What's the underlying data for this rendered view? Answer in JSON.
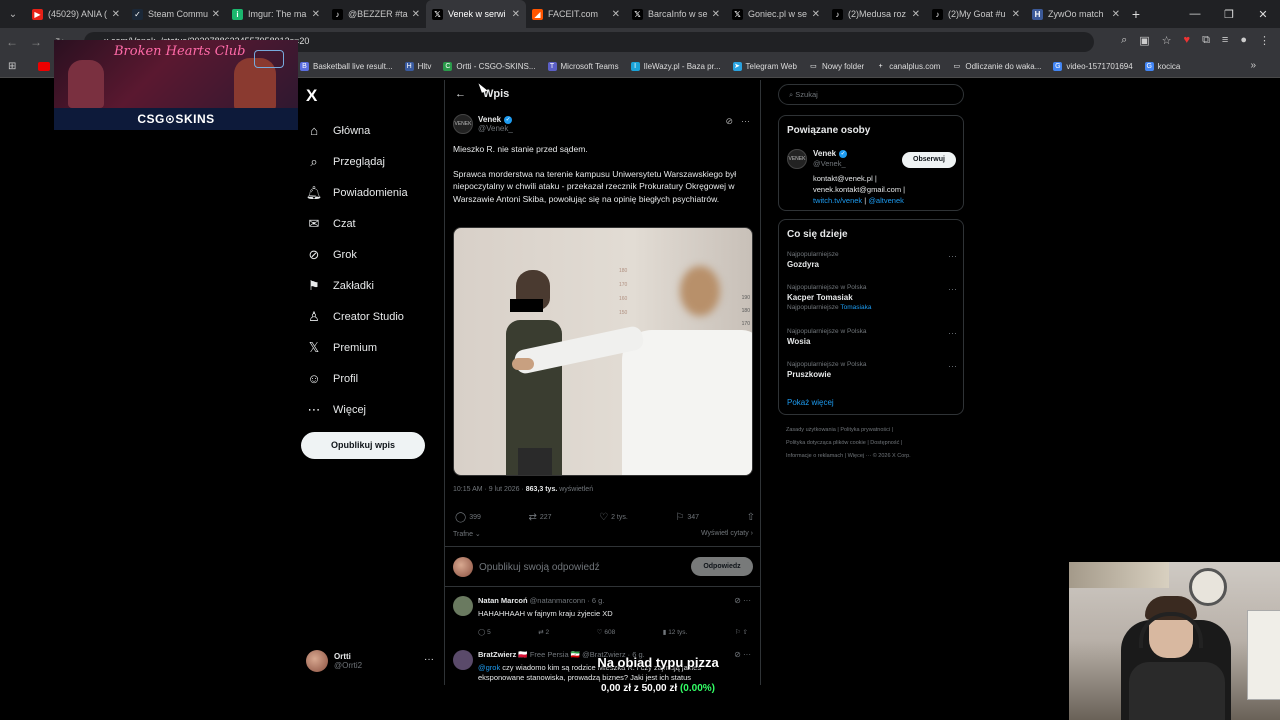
{
  "browser": {
    "tabs": [
      {
        "label": "(45029) ANIA (",
        "color": "#e62117",
        "icon": "youtube-icon",
        "glyph": "▶"
      },
      {
        "label": "Steam Commu",
        "color": "#1b2838",
        "icon": "steam-icon",
        "glyph": "✓"
      },
      {
        "label": "Imgur: The ma",
        "color": "#1bb76e",
        "icon": "imgur-icon",
        "glyph": "i"
      },
      {
        "label": "@BEZZER #ta",
        "color": "#000000",
        "icon": "tiktok-icon",
        "glyph": "♪"
      },
      {
        "label": "Venek w serwi",
        "color": "#000000",
        "icon": "x-icon",
        "glyph": "𝕏"
      },
      {
        "label": "FACEIT.com",
        "color": "#ff5500",
        "icon": "faceit-icon",
        "glyph": "◢"
      },
      {
        "label": "BarcaInfo w se",
        "color": "#000000",
        "icon": "x-icon",
        "glyph": "𝕏"
      },
      {
        "label": "Goniec.pl w se",
        "color": "#000000",
        "icon": "x-icon",
        "glyph": "𝕏"
      },
      {
        "label": "(2)Medusa roz",
        "color": "#000000",
        "icon": "tiktok-icon",
        "glyph": "♪"
      },
      {
        "label": "(2)My Goat #u",
        "color": "#000000",
        "icon": "tiktok-icon",
        "glyph": "♪"
      },
      {
        "label": "ZywOo match",
        "color": "#3b5998",
        "icon": "hltv-icon",
        "glyph": "H"
      }
    ],
    "active_tab": 4,
    "new_tab": "+",
    "url": "x.com/Venek_/status/20207886334557958913s=20",
    "window_controls": [
      "—",
      "❐",
      "✕"
    ],
    "bookmarks": [
      {
        "label": "Basketball live result...",
        "color": "#5b6ee1",
        "glyph": "B"
      },
      {
        "label": "Hltv",
        "color": "#3a5ba0",
        "glyph": "H"
      },
      {
        "label": "Ortti - CSGO-SKINS...",
        "color": "#2a9a4a",
        "glyph": "C"
      },
      {
        "label": "Microsoft Teams",
        "color": "#5b5fc7",
        "glyph": "T"
      },
      {
        "label": "IleWazy.pl - Baza pr...",
        "color": "#1aa3d9",
        "glyph": "I"
      },
      {
        "label": "Telegram Web",
        "color": "#2aa3e0",
        "glyph": "➤"
      },
      {
        "label": "Nowy folder",
        "color": "#35363a",
        "glyph": "▭"
      },
      {
        "label": "canalplus.com",
        "color": "#35363a",
        "glyph": "+"
      },
      {
        "label": "Odliczanie do waka...",
        "color": "#35363a",
        "glyph": "▭"
      },
      {
        "label": "video-1571701694",
        "color": "#4285f4",
        "glyph": "G"
      },
      {
        "label": "kocica",
        "color": "#4285f4",
        "glyph": "G"
      }
    ]
  },
  "banner": {
    "header": "Broken Hearts Club",
    "footer": "CSG⊙SKINS"
  },
  "x": {
    "logo": "X",
    "nav": [
      {
        "label": "Główna",
        "icon": "home-icon",
        "glyph": "⌂"
      },
      {
        "label": "Przeglądaj",
        "icon": "search-icon",
        "glyph": "⌕"
      },
      {
        "label": "Powiadomienia",
        "icon": "bell-icon",
        "glyph": "🔔︎"
      },
      {
        "label": "Czat",
        "icon": "chat-icon",
        "glyph": "✉"
      },
      {
        "label": "Grok",
        "icon": "grok-icon",
        "glyph": "⊘"
      },
      {
        "label": "Zakładki",
        "icon": "bookmark-icon",
        "glyph": "⚑"
      },
      {
        "label": "Creator Studio",
        "icon": "creator-studio-icon",
        "glyph": "♙"
      },
      {
        "label": "Premium",
        "icon": "x-premium-icon",
        "glyph": "𝕏"
      },
      {
        "label": "Profil",
        "icon": "profile-icon",
        "glyph": "☺"
      },
      {
        "label": "Więcej",
        "icon": "more-icon",
        "glyph": "⋯"
      }
    ],
    "post_button": "Opublikuj wpis",
    "me": {
      "name": "Ortti",
      "handle": "@Orrti2"
    }
  },
  "post": {
    "header_title": "Wpis",
    "author_name": "Venek",
    "author_handle": "@Venek_",
    "avatar_text": "VENEK",
    "text_p1": "Mieszko R. nie stanie przed sądem.",
    "text_p2": "Sprawca morderstwa na terenie kampusu Uniwersytetu Warszawskiego był niepoczytalny w chwili ataku - przekazał rzecznik Prokuratury Okręgowej w Warszawie Antoni Skiba, powołując się na opinię biegłych psychiatrów.",
    "meta_time": "10:15 AM · 9 lut 2026 · ",
    "meta_views": "863,3 tys.",
    "meta_views_label": " wyświetleń",
    "replies": "399",
    "reposts": "227",
    "likes": "2 tys.",
    "bookmarks": "347",
    "sort_label": "Trafne ⌄",
    "quotes_label": "Wyświetl cytaty ›",
    "reply_placeholder": "Opublikuj swoją odpowiedź",
    "reply_button": "Odpowiedz",
    "image_scale_left": [
      "180",
      "170",
      "160",
      "150"
    ],
    "image_scale_right": [
      "190",
      "180",
      "170",
      "160",
      "150"
    ]
  },
  "replies": [
    {
      "name": "Natan Marcoń",
      "meta": " @natanmarconn · 6 g.",
      "mention": "",
      "text": "HAHAHHAAH w fajnym kraju żyjecie XD",
      "replies": "5",
      "reposts": "2",
      "likes": "608",
      "views": "12 tys.",
      "color": "#6a7a60"
    },
    {
      "name": "BratZwierz",
      "meta": " 🇵🇱 Free Persia 🇮🇷 @BratZwierz · 6 g.",
      "mention": "@grok",
      "text": " czy wiadomo kim są rodzice Mieszka R. i czy zajmują jakieś eksponowane stanowiska, prowadzą biznes? Jaki jest ich status",
      "replies": "",
      "reposts": "",
      "likes": "",
      "views": "",
      "color": "#5a4a6a"
    }
  ],
  "right": {
    "search_placeholder": "⌕ Szukaj",
    "related_title": "Powiązane osoby",
    "related_name": "Venek",
    "related_handle": "@Venek_",
    "related_avatar": "VENEK",
    "follow": "Obserwuj",
    "bio_line1": "kontakt@venek.pl |",
    "bio_line2": "venek.kontakt@gmail.com |",
    "bio_link1": "twitch.tv/venek",
    "bio_sep": " | ",
    "bio_link2": "@altvenek",
    "trends_title": "Co się dzieje",
    "trends": [
      {
        "meta": "Najpopularniejsze",
        "name": "Gozdyra",
        "sub": "",
        "sub_link": ""
      },
      {
        "meta": "Najpopularniejsze w Polska",
        "name": "Kacper Tomasiak",
        "sub": "Najpopularniejsze ",
        "sub_link": "Tomasiaka"
      },
      {
        "meta": "Najpopularniejsze w Polska",
        "name": "Wosia",
        "sub": "",
        "sub_link": ""
      },
      {
        "meta": "Najpopularniejsze w Polska",
        "name": "Pruszkowie",
        "sub": "",
        "sub_link": ""
      }
    ],
    "show_more": "Pokaż więcej",
    "footer_line1": "Zasady użytkowania | Polityka prywatności |",
    "footer_line2": "Polityka dotycząca plików cookie | Dostępność |",
    "footer_line3": "Informacje o reklamach | Więcej ··· © 2026 X Corp."
  },
  "overlay": {
    "donate_title": "Na obiad typu pizza",
    "donate_current": "0,00 zł",
    "donate_of": " z ",
    "donate_goal": "50,00 zł",
    "donate_pct": " (0.00%)",
    "progress": 0.0
  }
}
